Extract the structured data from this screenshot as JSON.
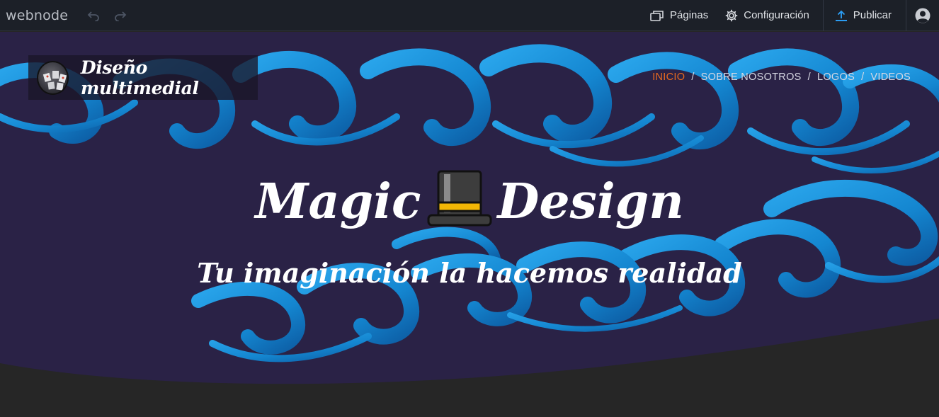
{
  "editor": {
    "brand": "webnode",
    "pages_label": "Páginas",
    "settings_label": "Configuración",
    "publish_label": "Publicar",
    "icons": [
      "undo-icon",
      "redo-icon",
      "pages-icon",
      "gear-icon",
      "upload-icon",
      "user-icon"
    ]
  },
  "site": {
    "logo_title": "Diseño multimedial",
    "nav": [
      {
        "label": "INICIO",
        "active": true
      },
      {
        "label": "SOBRE NOSOTROS",
        "active": false
      },
      {
        "label": "LOGOS",
        "active": false
      },
      {
        "label": "VIDEOS",
        "active": false
      }
    ],
    "nav_separator": "/",
    "headline_left": "Magic",
    "headline_right": "Design",
    "subtitle": "Tu imaginación la hacemos realidad"
  },
  "colors": {
    "topbar_bg": "#1c2028",
    "hero_bg": "#2a2246",
    "wave_blue": "#1a8fd6",
    "nav_active": "#e86a1f",
    "publish_icon": "#2b9cf2",
    "footer_dark": "#262626"
  }
}
